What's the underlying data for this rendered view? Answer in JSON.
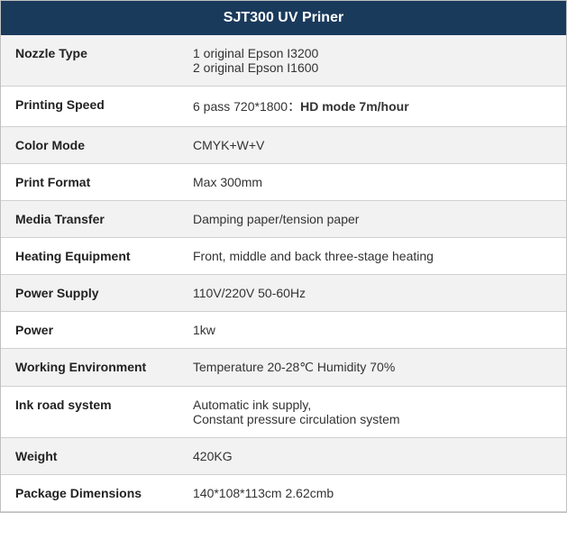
{
  "header": {
    "title": "SJT300 UV Priner"
  },
  "rows": [
    {
      "label": "Nozzle Type",
      "value": "1 original Epson I3200\n2 original Epson I1600",
      "bold_suffix": null
    },
    {
      "label": "Printing Speed",
      "value_prefix": "6 pass 720*1800：",
      "value_bold": "HD mode 7m/hour",
      "value": null
    },
    {
      "label": "Color Mode",
      "value": "CMYK+W+V",
      "bold_suffix": null
    },
    {
      "label": "Print Format",
      "value": "Max 300mm",
      "bold_suffix": null
    },
    {
      "label": "Media Transfer",
      "value": "Damping paper/tension paper",
      "bold_suffix": null
    },
    {
      "label": "Heating Equipment",
      "value": "Front, middle and back three-stage heating",
      "bold_suffix": null
    },
    {
      "label": "Power Supply",
      "value": "110V/220V 50-60Hz",
      "bold_suffix": null
    },
    {
      "label": "Power",
      "value": "1kw",
      "bold_suffix": null
    },
    {
      "label": "Working Environment",
      "value": "Temperature 20-28℃  Humidity 70%",
      "bold_suffix": null
    },
    {
      "label": "Ink road system",
      "value": "Automatic ink supply,\nConstant pressure circulation system",
      "bold_suffix": null
    },
    {
      "label": "Weight",
      "value": "420KG",
      "bold_suffix": null
    },
    {
      "label": "Package Dimensions",
      "value": "140*108*113cm  2.62cmb",
      "bold_suffix": null
    }
  ]
}
